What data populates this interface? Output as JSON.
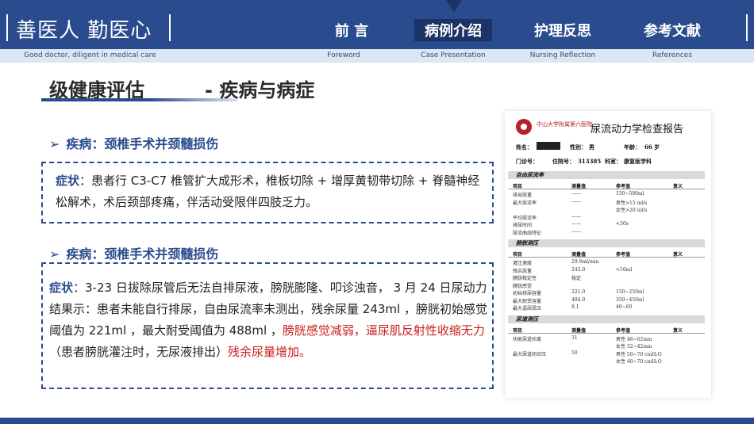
{
  "header": {
    "brand_title": "善医人 勤医心",
    "brand_subtitle": "Good doctor, diligent in medical care",
    "nav": [
      {
        "label": "前 言",
        "sub": "Foreword"
      },
      {
        "label": "病例介绍",
        "sub": "Case Presentation"
      },
      {
        "label": "护理反思",
        "sub": "Nursing Reflection"
      },
      {
        "label": "参考文献",
        "sub": "References"
      }
    ],
    "active_index": 1
  },
  "section": {
    "title": "级健康评估",
    "subtitle": "- 疾病与病症"
  },
  "blocks": [
    {
      "heading_arrow": "➢",
      "heading": "疾病：颈椎手术并颈髓损伤",
      "label": "症状",
      "text": "：患者行 C3-C7 椎管扩大成形术，椎板切除 + 增厚黄韧带切除 + 脊髓神经松解术，术后颈部疼痛，伴活动受限伴四肢乏力。"
    },
    {
      "heading_arrow": "➢",
      "heading": "疾病：颈椎手术并颈髓损伤",
      "label": "症状",
      "text_1": "：3-23 日拔除尿管后无法自排尿液，膀胱膨隆、叩诊浊音， 3 月 24 日尿动力结果示：患者未能自行排尿，自由尿流率未测出，残余尿量 243ml ，膀胱初始感觉阈值为 221ml ，最大耐受阈值为 488ml ，",
      "text_red_1": "膀胱感觉减弱，逼尿肌反射性收缩无力",
      "text_2": "（患者膀胱灌注时，无尿液排出）",
      "text_red_2": "残余尿量增加。"
    }
  ],
  "report": {
    "hospital": "中山大学附属第六医院",
    "title": "尿流动力学检查报告",
    "name_label": "姓名：",
    "sex_label": "性别：",
    "sex_value": "男",
    "age_label": "年龄：",
    "age_value": "66 岁",
    "outpatient_label": "门诊号：",
    "admission_label": "住院号：",
    "admission_value": "313385",
    "dept_label": "科室：",
    "dept_value": "康复医学科",
    "col_headers": [
      "项目",
      "测量值",
      "参考值",
      "意义"
    ],
    "sections": [
      {
        "name": "自由尿流率",
        "rows": [
          [
            "排出尿量",
            "——",
            "150~500ml"
          ],
          [
            "最大尿流率",
            "——",
            "男性>15 ml/s"
          ],
          [
            "",
            "",
            "女性>20 ml/s"
          ],
          [
            "平均尿流率",
            "——",
            ""
          ],
          [
            "排尿时间",
            "——",
            "<30s"
          ],
          [
            "尿流曲线特征",
            "——",
            ""
          ]
        ]
      },
      {
        "name": "膀胱测压",
        "rows": [
          [
            "灌注速度",
            "29.9ml/min",
            ""
          ],
          [
            "残余尿量",
            "243.0",
            "<10ml"
          ],
          [
            "膀胱稳定性",
            "稳定",
            ""
          ],
          [
            "膀胱感觉",
            "",
            ""
          ],
          [
            "初始排尿容量",
            "221.0",
            "150~250ml"
          ],
          [
            "最大耐受容量",
            "484.0",
            "350~450ml"
          ],
          [
            "最大逼尿肌压",
            "8.1",
            "40~60"
          ]
        ]
      },
      {
        "name": "尿道测压",
        "rows": [
          [
            "功能尿道长度",
            "31",
            "男性 46~62mm"
          ],
          [
            "",
            "",
            "女性 32~42mm"
          ],
          [
            "最大尿道闭合压",
            "50",
            "男性 50~70 cmH₂O"
          ],
          [
            "",
            "",
            "女性 40~70 cmH₂O"
          ]
        ]
      }
    ]
  }
}
